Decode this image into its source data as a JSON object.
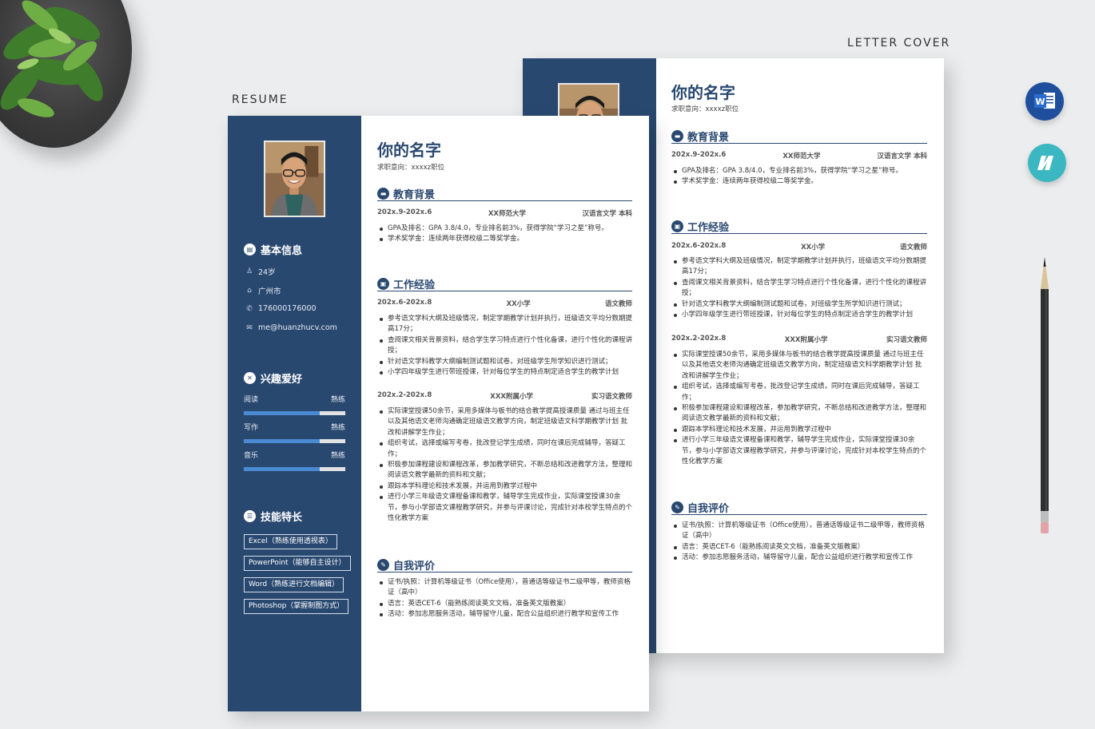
{
  "captions": {
    "resume": "RESUME",
    "letter_cover": "LETTER COVER"
  },
  "apps": {
    "word_icon": "word-icon",
    "other_icon": "n-app-icon",
    "word_letter": "W"
  },
  "colors": {
    "navy": "#294870",
    "accent_bar": "#4a8ad3",
    "background": "#ecedee"
  },
  "resume": {
    "name": "你的名字",
    "intent": "求职意向：xxxxz职位",
    "sidebar": {
      "basic_title": "基本信息",
      "basic": [
        {
          "icon": "person-icon",
          "text": "24岁"
        },
        {
          "icon": "building-icon",
          "text": "广州市"
        },
        {
          "icon": "phone-icon",
          "text": "176000176000"
        },
        {
          "icon": "mail-icon",
          "text": "me@huanzhucv.com"
        }
      ],
      "hobby_title": "兴趣爱好",
      "hobbies": [
        {
          "name": "阅读",
          "level": "熟练",
          "fraction": 0.75
        },
        {
          "name": "写作",
          "level": "熟练",
          "fraction": 0.75
        },
        {
          "name": "音乐",
          "level": "熟练",
          "fraction": 0.75
        }
      ],
      "skills_title": "技能特长",
      "skills": [
        "Excel（熟练使用透视表）",
        "PowerPoint（能够自主设计）",
        "Word（熟练进行文档编辑）",
        "Photoshop（掌握制图方式）"
      ]
    },
    "education": {
      "title": "教育背景",
      "period": "202x.9-202x.6",
      "school": "XX师范大学",
      "major": "汉语言文学 本科",
      "bullets": [
        "GPA及排名：GPA 3.8/4.0，专业排名前3%，获得学院“学习之星”称号。",
        "学术奖学金：连续两年获得校级二等奖学金。"
      ]
    },
    "work": {
      "title": "工作经验",
      "jobs": [
        {
          "period": "202x.6-202x.8",
          "org": "XX小学",
          "role": "语文教师",
          "bullets": [
            "参考语文学科大纲及班级情况，制定学期教学计划并执行，班级语文平均分数期提高17分；",
            "查阅课文相关背景资料，结合学生学习特点进行个性化备课，进行个性化的课程讲授；",
            "针对语文学科教学大纲编制测试题和试卷，对班级学生所学知识进行测试；",
            "小学四年级学生进行带班授课，针对每位学生的特点制定适合学生的教学计划"
          ]
        },
        {
          "period": "202x.2-202x.8",
          "org": "XXX附属小学",
          "role": "实习语文教师",
          "bullets": [
            "实际课堂授课50余节，采用多媒体与板书的结合教学提高授课质量 通过与班主任以及其他语文老师沟通确定班级语文教学方向，制定班级语文科学期教学计划 批改和讲解学生作业；",
            "组织考试，选择或编写考卷，批改登记学生成绩，同时在课后完成辅导，答疑工作；",
            "积极参加课程建设和课程改革，参加教学研究，不断总结和改进教学方法，整理和阅读语文教学最新的资料和文献；",
            "跟踪本学科理论和技术发展，并运用到教学过程中",
            "进行小学三年级语文课程备课和教学，辅导学生完成作业，实际课堂授课30余节，参与小学部语文课程教学研究，并参与评课讨论，完成针对本校学生特点的个性化教学方案"
          ]
        }
      ]
    },
    "self": {
      "title": "自我评价",
      "bullets": [
        "证书/执照：计算机等级证书（Office使用），普通话等级证书二级甲等，教师资格证（高中）",
        "语言：英语CET-6（能熟练阅读英文文档，准备英文版教案）",
        "活动：参加志愿服务活动，辅导留守儿童，配合公益组织进行教学和宣传工作"
      ]
    }
  }
}
